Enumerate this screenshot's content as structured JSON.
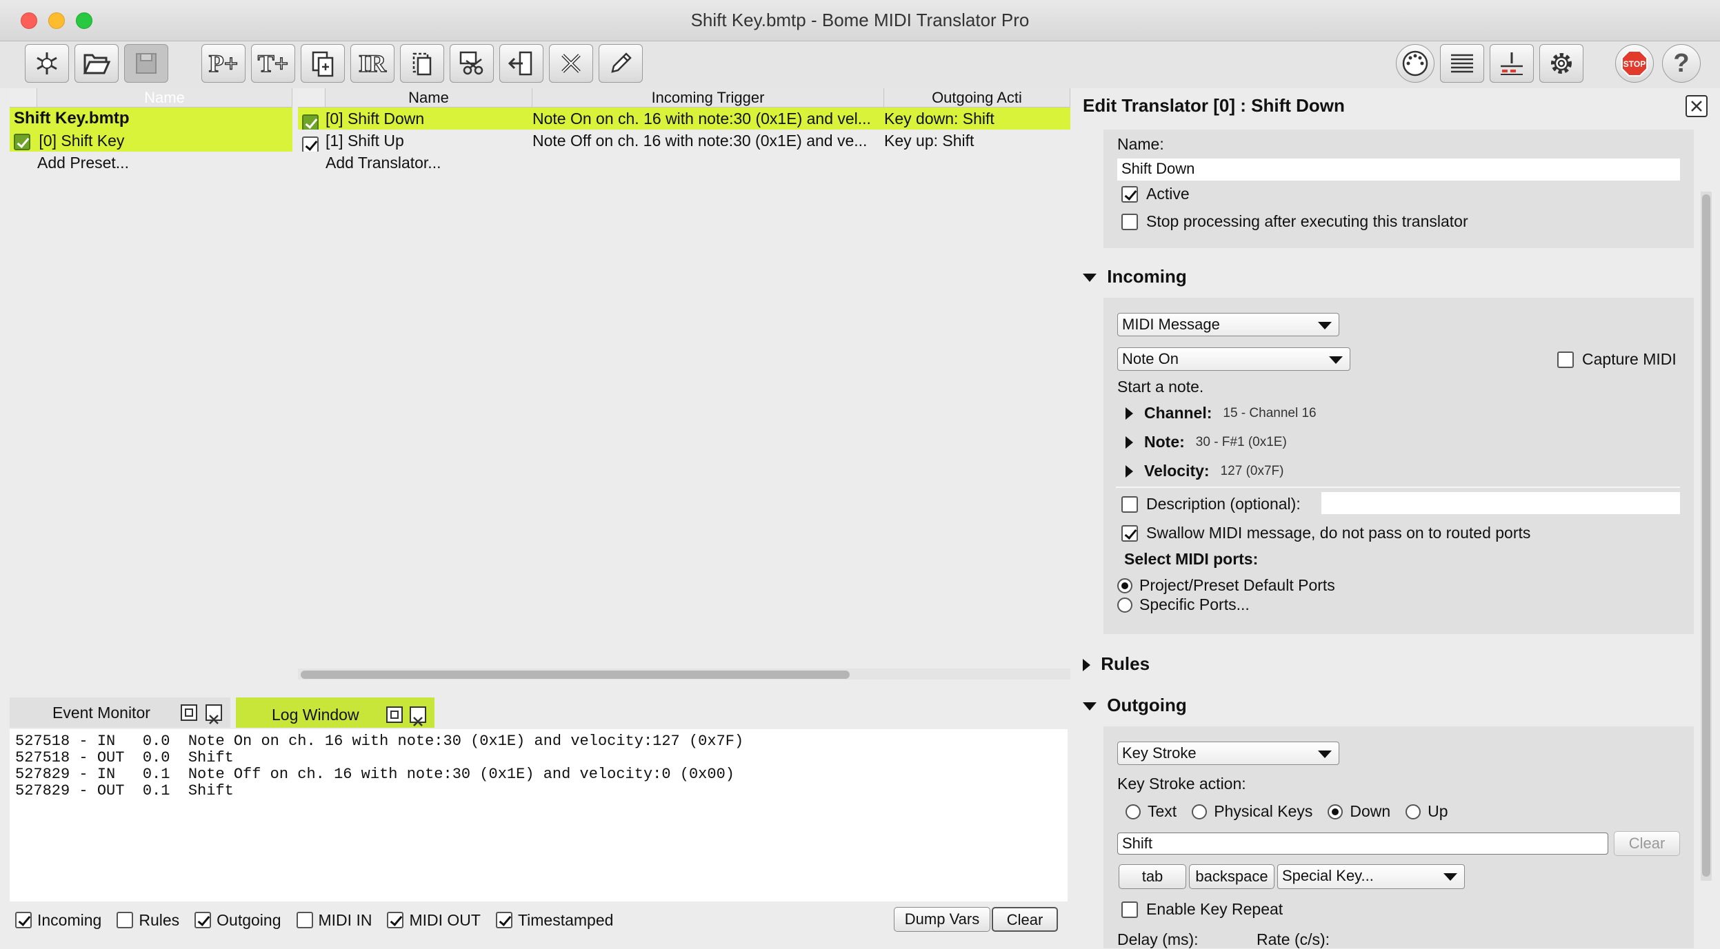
{
  "window": {
    "title": "Shift Key.bmtp - Bome MIDI Translator Pro"
  },
  "toolbar": {
    "left_icons": [
      "new-project-icon",
      "open-folder-icon",
      "save-icon",
      "add-preset-icon",
      "add-translator-icon",
      "duplicate-icon",
      "incoming-rules-icon",
      "copy-icon",
      "cut-icon",
      "paste-icon",
      "delete-icon",
      "edit-pencil-icon"
    ],
    "add_preset_label": "P+",
    "add_translator_label": "T+",
    "ir_label": "IR",
    "right_icons": [
      "midi-ports-icon",
      "log-window-icon",
      "event-monitor-icon",
      "settings-gear-icon",
      "stop-icon",
      "help-icon"
    ],
    "stop_label": "STOP",
    "help_label": "?"
  },
  "presets": {
    "header": "Name",
    "project_name": "Shift Key.bmtp",
    "items": [
      {
        "label": "[0] Shift Key",
        "checked": true
      }
    ],
    "add_label": "Add Preset..."
  },
  "translators": {
    "headers": {
      "name": "Name",
      "incoming": "Incoming Trigger",
      "outgoing": "Outgoing Acti"
    },
    "rows": [
      {
        "name": "[0] Shift Down",
        "incoming": "Note On on ch. 16 with note:30 (0x1E) and vel...",
        "outgoing": "Key down: Shift",
        "checked": true
      },
      {
        "name": "[1] Shift Up",
        "incoming": "Note Off on ch. 16 with note:30 (0x1E) and ve...",
        "outgoing": "Key up: Shift",
        "checked": true
      }
    ],
    "add_label": "Add Translator..."
  },
  "bottom": {
    "tabs": {
      "event_monitor": "Event Monitor",
      "log_window": "Log Window"
    },
    "log_lines": [
      "527518 - IN   0.0  Note On on ch. 16 with note:30 (0x1E) and velocity:127 (0x7F)",
      "527518 - OUT  0.0  Shift",
      "527829 - IN   0.1  Note Off on ch. 16 with note:30 (0x1E) and velocity:0 (0x00)",
      "527829 - OUT  0.1  Shift"
    ],
    "filters": [
      {
        "label": "Incoming",
        "checked": true
      },
      {
        "label": "Rules",
        "checked": false
      },
      {
        "label": "Outgoing",
        "checked": true
      },
      {
        "label": "MIDI IN",
        "checked": false
      },
      {
        "label": "MIDI OUT",
        "checked": true
      },
      {
        "label": "Timestamped",
        "checked": true
      }
    ],
    "dump_vars": "Dump Vars",
    "clear": "Clear"
  },
  "editor": {
    "title": "Edit Translator [0] : Shift Down",
    "name_label": "Name:",
    "name_value": "Shift Down",
    "active_label": "Active",
    "stop_processing_label": "Stop processing after executing this translator",
    "incoming": {
      "section": "Incoming",
      "type": "MIDI Message",
      "message": "Note On",
      "capture_label": "Capture MIDI",
      "desc": "Start a note.",
      "channel_label": "Channel:",
      "channel_value": "15 - Channel 16",
      "note_label": "Note:",
      "note_value": "30 - F#1 (0x1E)",
      "velocity_label": "Velocity:",
      "velocity_value": "127 (0x7F)",
      "description_label": "Description (optional):",
      "swallow_label": "Swallow MIDI message, do not pass on to routed ports",
      "select_ports_label": "Select MIDI ports:",
      "port_default": "Project/Preset Default Ports",
      "port_specific": "Specific Ports..."
    },
    "rules": {
      "section": "Rules"
    },
    "outgoing": {
      "section": "Outgoing",
      "type": "Key Stroke",
      "action_label": "Key Stroke action:",
      "opt_text": "Text",
      "opt_physical": "Physical Keys",
      "opt_down": "Down",
      "opt_up": "Up",
      "key_value": "Shift",
      "clear_label": "Clear",
      "tab_btn": "tab",
      "backspace_btn": "backspace",
      "special_key": "Special Key...",
      "key_repeat_label": "Enable Key Repeat",
      "delay_label": "Delay (ms):",
      "rate_label": "Rate (c/s):"
    }
  },
  "colors": {
    "highlight": "#d9f23a",
    "check_green": "#6fa428",
    "stop_red": "#e23b2e"
  }
}
